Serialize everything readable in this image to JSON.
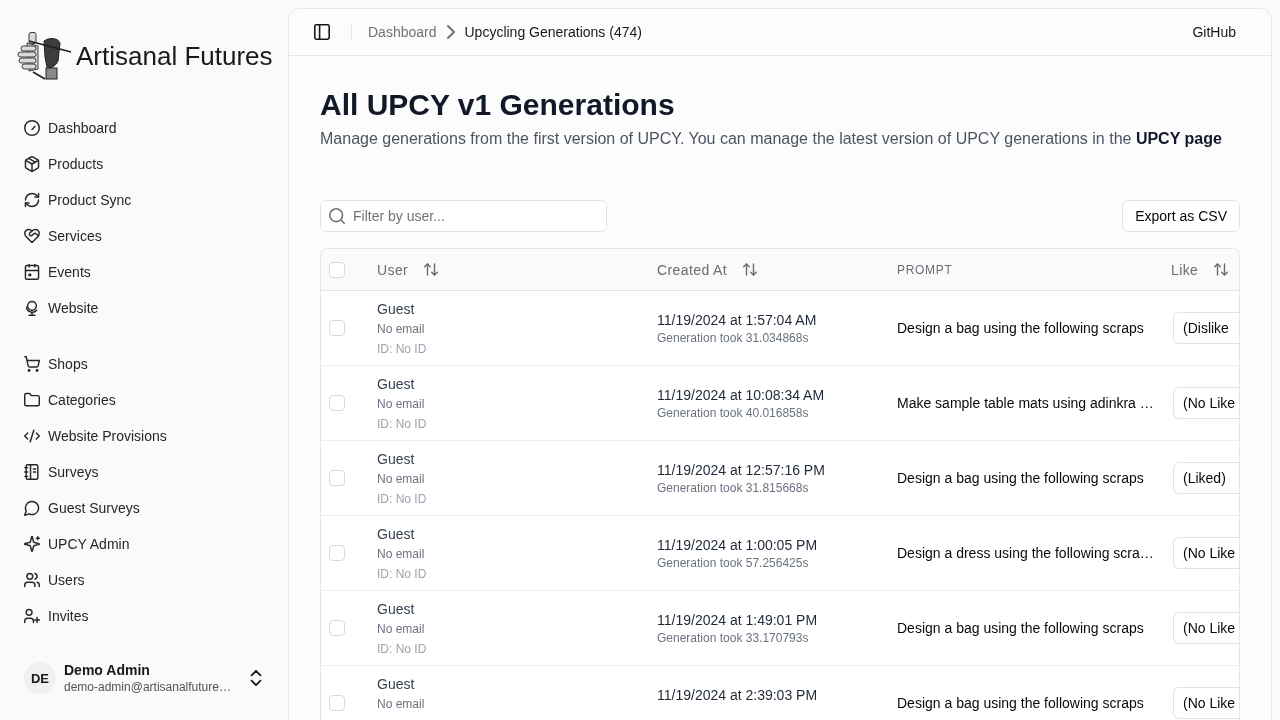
{
  "sidebar": {
    "brand": "Artisanal Futures",
    "nav_groups": [
      [
        {
          "label": "Dashboard",
          "selected": false
        },
        {
          "label": "Products",
          "selected": false
        },
        {
          "label": "Product Sync",
          "selected": false
        },
        {
          "label": "Services",
          "selected": false
        },
        {
          "label": "Events",
          "selected": false
        },
        {
          "label": "Website",
          "selected": false
        }
      ],
      [
        {
          "label": "Shops",
          "selected": false
        },
        {
          "label": "Categories",
          "selected": false
        },
        {
          "label": "Website Provisions",
          "selected": false
        },
        {
          "label": "Surveys",
          "selected": false
        },
        {
          "label": "Guest Surveys",
          "selected": false
        },
        {
          "label": "UPCY Admin",
          "selected": false
        },
        {
          "label": "Users",
          "selected": false
        },
        {
          "label": "Invites",
          "selected": false
        }
      ]
    ],
    "user": {
      "initials": "DE",
      "name": "Demo Admin",
      "email": "demo-admin@artisanalfuture…"
    }
  },
  "header": {
    "breadcrumb": [
      {
        "label": "Dashboard",
        "current": false
      },
      {
        "label": "Upcycling Generations (474)",
        "current": true
      }
    ],
    "github_link": "GitHub"
  },
  "page": {
    "title": "All UPCY v1 Generations",
    "description": "Manage generations from the first version of UPCY. You can manage the latest version of UPCY generations in the **UPCY page**"
  },
  "toolbar": {
    "filter": {
      "placeholder": "Filter by user..."
    },
    "export_button": "Export as CSV"
  },
  "table": {
    "select_all": {
      "checked": false
    },
    "columns": [
      {
        "label": "User",
        "sortable": true
      },
      {
        "label": "Created At",
        "sortable": true
      },
      {
        "label": "PROMPT",
        "sortable": false
      },
      {
        "label": "Like",
        "sortable": true
      }
    ],
    "rows": [
      {
        "checked": false,
        "user": {
          "name": "Guest",
          "email": "No email",
          "id": "ID: No ID"
        },
        "created_at": "11/19/2024 at 1:57:04 AM",
        "duration": "Generation took 31.034868s",
        "prompt": "Design a bag using the following scraps",
        "like": "(Dislike"
      },
      {
        "checked": false,
        "user": {
          "name": "Guest",
          "email": "No email",
          "id": "ID: No ID"
        },
        "created_at": "11/19/2024 at 10:08:34 AM",
        "duration": "Generation took 40.016858s",
        "prompt": "Make sample table mats using adinkra …",
        "like": "(No Like"
      },
      {
        "checked": false,
        "user": {
          "name": "Guest",
          "email": "No email",
          "id": "ID: No ID"
        },
        "created_at": "11/19/2024 at 12:57:16 PM",
        "duration": "Generation took 31.815668s",
        "prompt": "Design a bag using the following scraps",
        "like": "(Liked)"
      },
      {
        "checked": false,
        "user": {
          "name": "Guest",
          "email": "No email",
          "id": "ID: No ID"
        },
        "created_at": "11/19/2024 at 1:00:05 PM",
        "duration": "Generation took 57.256425s",
        "prompt": "Design a dress using the following scra…",
        "like": "(No Like"
      },
      {
        "checked": false,
        "user": {
          "name": "Guest",
          "email": "No email",
          "id": "ID: No ID"
        },
        "created_at": "11/19/2024 at 1:49:01 PM",
        "duration": "Generation took 33.170793s",
        "prompt": "Design a bag using the following scraps",
        "like": "(No Like"
      },
      {
        "checked": false,
        "user": {
          "name": "Guest",
          "email": "No email"
        },
        "created_at": "11/19/2024 at 2:39:03 PM",
        "prompt": "Design a bag using the following scraps",
        "like": "(No Like"
      }
    ]
  }
}
